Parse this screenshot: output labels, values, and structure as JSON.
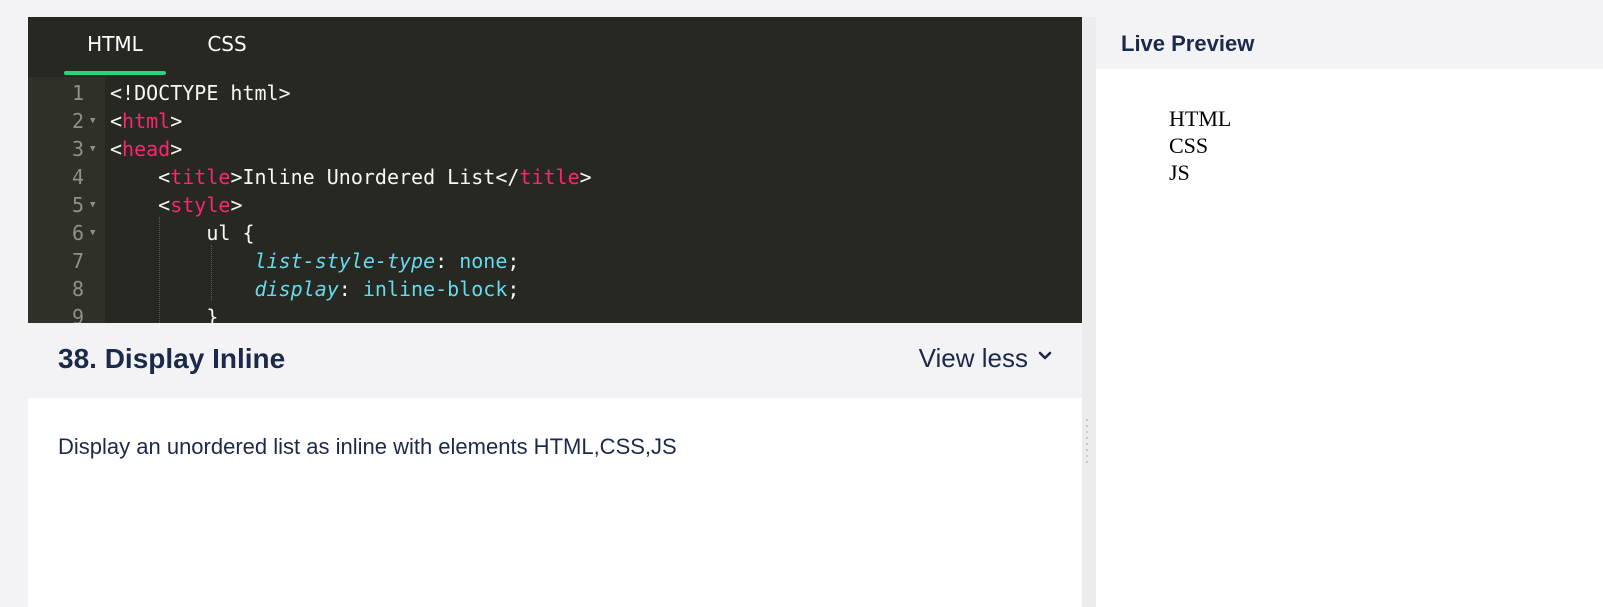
{
  "editor": {
    "tabs": [
      {
        "label": "HTML",
        "active": true
      },
      {
        "label": "CSS",
        "active": false
      }
    ],
    "accent_color": "#2cd27e",
    "lines": [
      {
        "num": "1",
        "fold": false,
        "segments": [
          {
            "t": "<!DOCTYPE html>",
            "c": ""
          }
        ]
      },
      {
        "num": "2",
        "fold": true,
        "segments": [
          {
            "t": "<",
            "c": ""
          },
          {
            "t": "html",
            "c": "tag"
          },
          {
            "t": ">",
            "c": ""
          }
        ]
      },
      {
        "num": "3",
        "fold": true,
        "segments": [
          {
            "t": "<",
            "c": ""
          },
          {
            "t": "head",
            "c": "tag"
          },
          {
            "t": ">",
            "c": ""
          }
        ]
      },
      {
        "num": "4",
        "fold": false,
        "segments": [
          {
            "t": "    <",
            "c": ""
          },
          {
            "t": "title",
            "c": "tag"
          },
          {
            "t": ">Inline Unordered List</",
            "c": ""
          },
          {
            "t": "title",
            "c": "tag"
          },
          {
            "t": ">",
            "c": ""
          }
        ]
      },
      {
        "num": "5",
        "fold": true,
        "segments": [
          {
            "t": "    <",
            "c": ""
          },
          {
            "t": "style",
            "c": "tag"
          },
          {
            "t": ">",
            "c": ""
          }
        ]
      },
      {
        "num": "6",
        "fold": true,
        "segments": [
          {
            "t": "        ul {",
            "c": ""
          }
        ]
      },
      {
        "num": "7",
        "fold": false,
        "segments": [
          {
            "t": "            ",
            "c": ""
          },
          {
            "t": "list-style-type",
            "c": "prop"
          },
          {
            "t": ": ",
            "c": ""
          },
          {
            "t": "none",
            "c": "val"
          },
          {
            "t": ";",
            "c": ""
          }
        ]
      },
      {
        "num": "8",
        "fold": false,
        "segments": [
          {
            "t": "            ",
            "c": ""
          },
          {
            "t": "display",
            "c": "prop"
          },
          {
            "t": ": ",
            "c": ""
          },
          {
            "t": "inline-block",
            "c": "val"
          },
          {
            "t": ";",
            "c": ""
          }
        ]
      },
      {
        "num": "9",
        "fold": false,
        "segments": [
          {
            "t": "        }",
            "c": ""
          }
        ]
      }
    ]
  },
  "question": {
    "title": "38. Display Inline",
    "toggle_label": "View less",
    "description": "Display an unordered list as inline with elements HTML,CSS,JS"
  },
  "preview": {
    "title": "Live Preview",
    "items": [
      "HTML",
      "CSS",
      "JS"
    ]
  }
}
